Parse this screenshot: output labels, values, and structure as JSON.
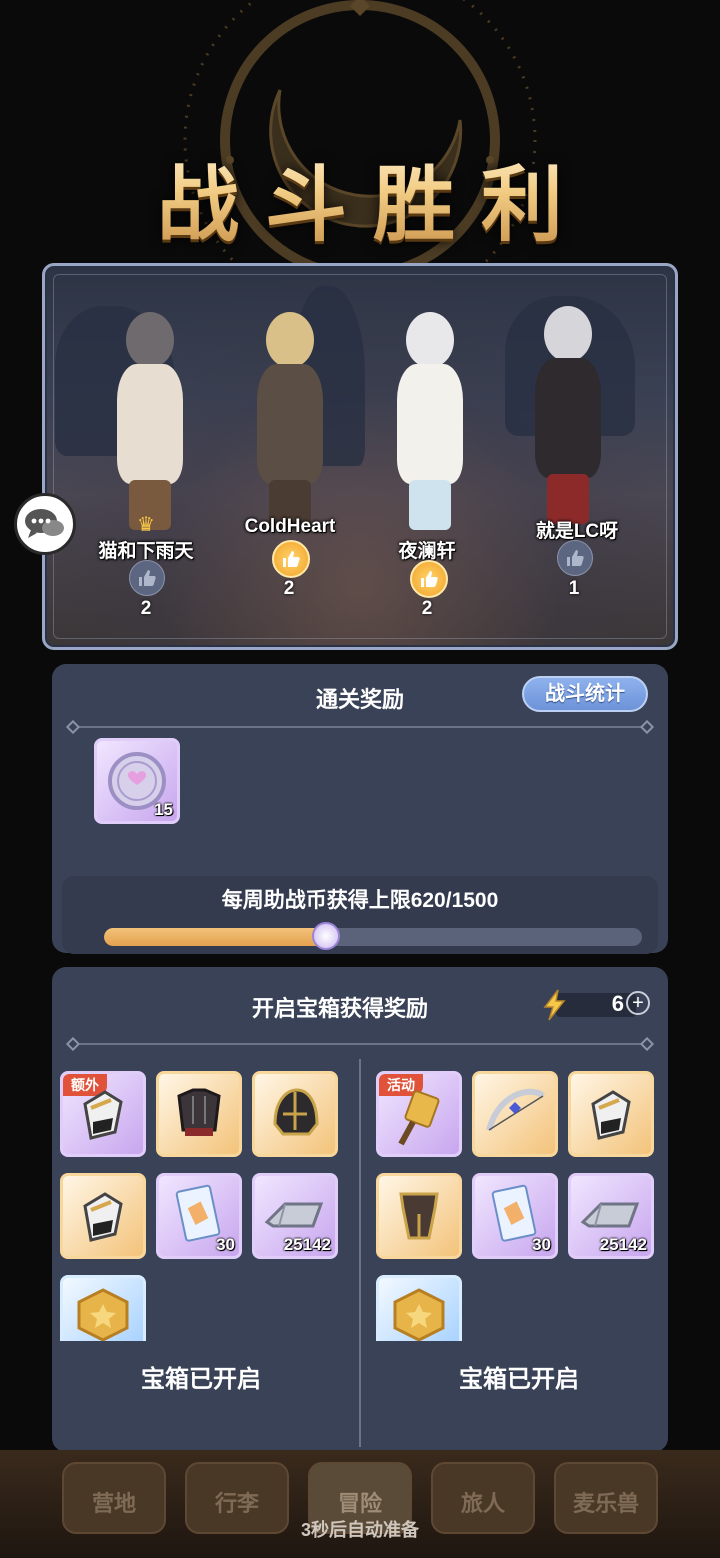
{
  "header": {
    "title": "战斗胜利"
  },
  "party": [
    {
      "name": "猫和下雨天",
      "likes": "2",
      "liked": false,
      "crown": true
    },
    {
      "name": "ColdHeart",
      "likes": "2",
      "liked": true,
      "crown": false
    },
    {
      "name": "夜澜轩",
      "likes": "2",
      "liked": true,
      "crown": false
    },
    {
      "name": "就是LC呀",
      "likes": "1",
      "liked": false,
      "crown": false
    }
  ],
  "clear_rewards": {
    "title": "通关奖励",
    "stats_button": "战斗统计",
    "item_qty": "15",
    "weekly_label": "每周助战币获得上限620/1500",
    "weekly_progress": 0.4133
  },
  "chest_rewards": {
    "title": "开启宝箱获得奖励",
    "energy": "6",
    "energy_plus": "+",
    "left": {
      "tag": "额外",
      "qty_ticket": "30",
      "qty_ingot": "25142",
      "status": "宝箱已开启"
    },
    "right": {
      "tag": "活动",
      "qty_ticket": "30",
      "qty_ingot": "25142",
      "status": "宝箱已开启"
    }
  },
  "nav": {
    "tabs": [
      "营地",
      "行李",
      "冒险",
      "旅人",
      "麦乐兽"
    ],
    "active": "冒险"
  },
  "footer": {
    "auto_ready": "3秒后自动准备"
  },
  "colors": {
    "panel": "#3a4257",
    "accent_gold": "#f2cc84",
    "button_blue": "#7ea3e4",
    "progress": "#e4a24e"
  }
}
